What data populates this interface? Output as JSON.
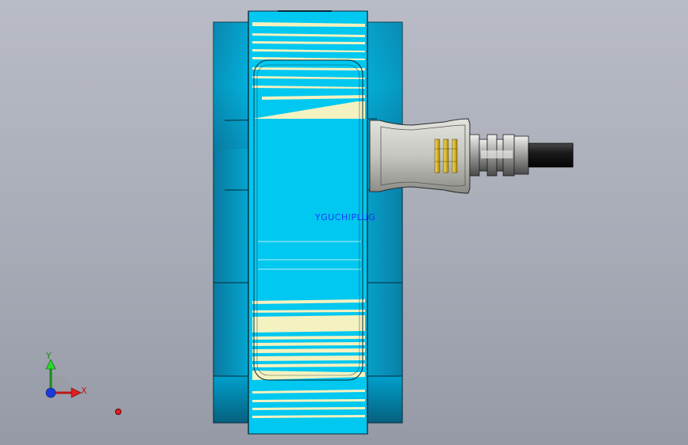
{
  "viewport": {
    "background_top": "#b9bcc6",
    "background_bottom": "#969aa6"
  },
  "model": {
    "body_color": "#00c8f0",
    "ring_color": "#00a8d8",
    "winding_color": "#f4f2c0",
    "plug_color": "#c8c8c4",
    "pin_color": "#e0c020",
    "cable_color": "#202020",
    "edge_color": "#102030"
  },
  "feature_label": {
    "text": "YGUCHIPLUG",
    "color": "#2020ff"
  },
  "axis_triad": {
    "x_label": "X",
    "y_label": "Y",
    "x_color": "#c01818",
    "y_color": "#1a8a1a",
    "z_color": "#1a3ad8"
  },
  "origin_marker": {
    "color": "#e02020"
  }
}
